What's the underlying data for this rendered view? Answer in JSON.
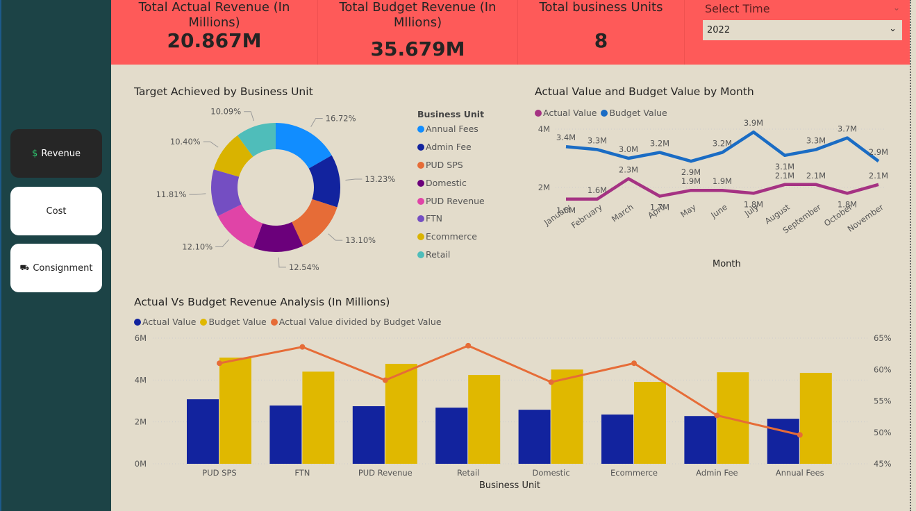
{
  "sidebar": {
    "items": [
      {
        "label": "Revenue",
        "icon": "dollar-icon",
        "active": true
      },
      {
        "label": "Cost"
      },
      {
        "label": "Consignment",
        "icon": "truck-icon"
      }
    ]
  },
  "kpis": [
    {
      "title": "Total Actual Revenue (In Millions)",
      "value": "20.867M"
    },
    {
      "title": "Total Budget Revenue (In Mllions)",
      "value": "35.679M"
    },
    {
      "title": "Total business Units",
      "value": "8"
    }
  ],
  "slicer": {
    "label": "Select Time",
    "value": "2022"
  },
  "colors": {
    "kpi_bg": "#fe5a59",
    "sidebar": "#1c4346",
    "page": "#e3dccb",
    "actual_line": "#a53283",
    "budget_line": "#1a6cc4",
    "actual_bar": "#12239e",
    "budget_bar": "#e0b800",
    "ratio": "#e66c37"
  },
  "chart_data": [
    {
      "type": "pie",
      "title": "Target Achieved by Business Unit",
      "legend_title": "Business Unit",
      "donut": true,
      "categories": [
        "Annual Fees",
        "Admin Fee",
        "PUD SPS",
        "Domestic",
        "PUD Revenue",
        "FTN",
        "Ecommerce",
        "Retail"
      ],
      "values": [
        16.72,
        13.23,
        13.1,
        12.54,
        12.1,
        11.81,
        10.4,
        10.09
      ],
      "labels": [
        "16.72%",
        "13.23%",
        "13.10%",
        "12.54%",
        "12.10%",
        "11.81%",
        "10.40%",
        "10.09%"
      ],
      "colors": [
        "#118dff",
        "#12239e",
        "#e66c37",
        "#6b007b",
        "#e044a7",
        "#744ec2",
        "#d9b300",
        "#4fbdba"
      ]
    },
    {
      "type": "line",
      "title": "Actual Value and Budget Value by Month",
      "xlabel": "Month",
      "yticks": [
        "2M",
        "4M"
      ],
      "categories": [
        "January",
        "February",
        "March",
        "April",
        "May",
        "June",
        "July",
        "August",
        "September",
        "October",
        "November"
      ],
      "series": [
        {
          "name": "Actual Value",
          "values": [
            1.6,
            1.6,
            2.3,
            1.7,
            1.9,
            1.9,
            1.8,
            2.1,
            2.1,
            1.8,
            2.1
          ],
          "color": "#a53283"
        },
        {
          "name": "Budget Value",
          "values": [
            3.4,
            3.3,
            3.0,
            3.2,
            2.9,
            3.2,
            3.9,
            3.1,
            3.3,
            3.7,
            2.9
          ],
          "color": "#1a6cc4"
        }
      ]
    },
    {
      "type": "bar",
      "title": "Actual Vs Budget Revenue Analysis (In Millions)",
      "xlabel": "Business Unit",
      "categories": [
        "PUD SPS",
        "FTN",
        "PUD Revenue",
        "Retail",
        "Domestic",
        "Ecommerce",
        "Admin Fee",
        "Annual Fees"
      ],
      "yticks": [
        "0M",
        "2M",
        "4M",
        "6M"
      ],
      "ylim": [
        0,
        6
      ],
      "y2ticks": [
        "45%",
        "50%",
        "55%",
        "60%",
        "65%"
      ],
      "y2lim": [
        45,
        65
      ],
      "series": [
        {
          "name": "Actual Value",
          "values": [
            3.08,
            2.78,
            2.75,
            2.68,
            2.58,
            2.35,
            2.28,
            2.15
          ],
          "color": "#12239e"
        },
        {
          "name": "Budget Value",
          "values": [
            5.07,
            4.4,
            4.77,
            4.24,
            4.5,
            3.91,
            4.37,
            4.34
          ],
          "color": "#e0b800"
        },
        {
          "name": "Actual Value divided by Budget Value",
          "type": "line",
          "axis": "right",
          "values": [
            61.0,
            63.6,
            58.3,
            63.8,
            58.0,
            61.0,
            52.7,
            49.6
          ],
          "color": "#e66c37"
        }
      ]
    }
  ]
}
